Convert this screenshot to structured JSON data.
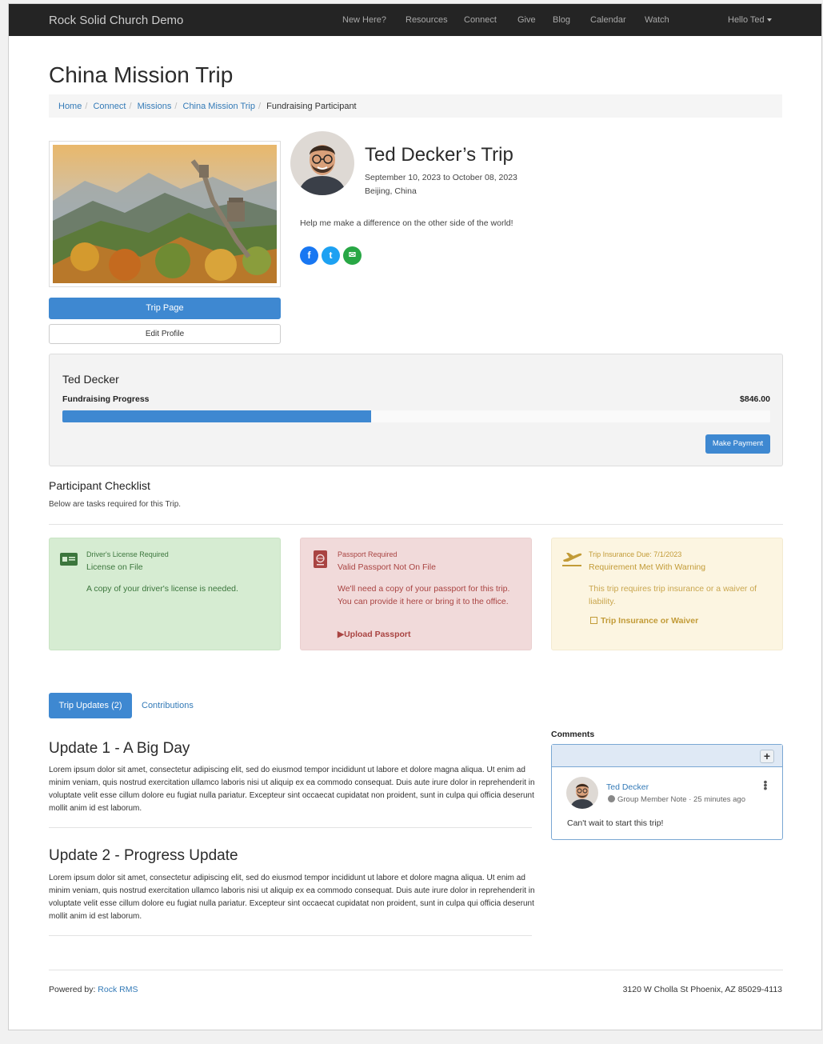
{
  "navbar": {
    "brand": "Rock Solid Church Demo",
    "links": [
      "New Here?",
      "Resources",
      "Connect",
      "Give",
      "Blog",
      "Calendar",
      "Watch"
    ],
    "user_menu": "Hello Ted"
  },
  "page": {
    "title": "China Mission Trip",
    "breadcrumb": [
      "Home",
      "Connect",
      "Missions",
      "China Mission Trip",
      "Fundraising Participant"
    ]
  },
  "profile": {
    "trip_title": "Ted Decker’s Trip",
    "dates": "September 10, 2023 to October 08, 2023",
    "location": "Beijing, China",
    "tagline": "Help me make a difference on the other side of the world!",
    "trip_page_button": "Trip Page",
    "edit_profile_button": "Edit Profile",
    "social": {
      "facebook": {
        "icon": "facebook-icon",
        "glyph": "f",
        "color": "#1877f2"
      },
      "twitter": {
        "icon": "twitter-icon",
        "glyph": "t",
        "color": "#1da1f2"
      },
      "email": {
        "icon": "email-icon",
        "glyph": "✉",
        "color": "#28a745"
      }
    }
  },
  "fundraising": {
    "name": "Ted Decker",
    "label": "Fundraising Progress",
    "amount": "$846.00",
    "progress_percent": 43.6,
    "button": "Make Payment"
  },
  "checklist": {
    "title": "Participant Checklist",
    "subtitle": "Below are tasks required for this Trip.",
    "items": [
      {
        "icon": "id-card-icon",
        "header": "Driver's License Required",
        "status": "License on File",
        "body": "A copy of your driver's license is needed.",
        "color": "#3c763d"
      },
      {
        "icon": "passport-icon",
        "header": "Passport Required",
        "status": "Valid Passport Not On File",
        "body": "We'll need a copy of your passport for this trip. You can provide it here or bring it to the office.",
        "action": "Upload Passport",
        "color": "#a94442"
      },
      {
        "icon": "plane-departure-icon",
        "header": "Trip Insurance",
        "due": "Due: 7/1/2023",
        "status": "Requirement Met With Warning",
        "body": "This trip requires trip insurance or a waiver of liability.",
        "action": "Trip Insurance or Waiver",
        "color": "#c29b37"
      }
    ]
  },
  "tabs": {
    "updates": "Trip Updates (2)",
    "contributions": "Contributions"
  },
  "updates": [
    {
      "title": "Update 1 - A Big Day",
      "body": "Lorem ipsum dolor sit amet, consectetur adipiscing elit, sed do eiusmod tempor incididunt ut labore et dolore magna aliqua. Ut enim ad minim veniam, quis nostrud exercitation ullamco laboris nisi ut aliquip ex ea commodo consequat. Duis aute irure dolor in reprehenderit in voluptate velit esse cillum dolore eu fugiat nulla pariatur. Excepteur sint occaecat cupidatat non proident, sunt in culpa qui officia deserunt mollit anim id est laborum."
    },
    {
      "title": "Update 2 - Progress Update",
      "body": "Lorem ipsum dolor sit amet, consectetur adipiscing elit, sed do eiusmod tempor incididunt ut labore et dolore magna aliqua. Ut enim ad minim veniam, quis nostrud exercitation ullamco laboris nisi ut aliquip ex ea commodo consequat. Duis aute irure dolor in reprehenderit in voluptate velit esse cillum dolore eu fugiat nulla pariatur. Excepteur sint occaecat cupidatat non proident, sunt in culpa qui officia deserunt mollit anim id est laborum."
    }
  ],
  "comments": {
    "title": "Comments",
    "add_glyph": "+",
    "items": [
      {
        "author": "Ted Decker",
        "meta": "Group Member Note · 25 minutes ago",
        "text": "Can't wait to start this trip!"
      }
    ]
  },
  "footer": {
    "powered_label": "Powered by:",
    "powered_link": "Rock RMS",
    "address": "3120 W Cholla St Phoenix, AZ 85029-4113"
  },
  "colors": {
    "primary": "#3e88d1",
    "navbar": "#242424"
  }
}
